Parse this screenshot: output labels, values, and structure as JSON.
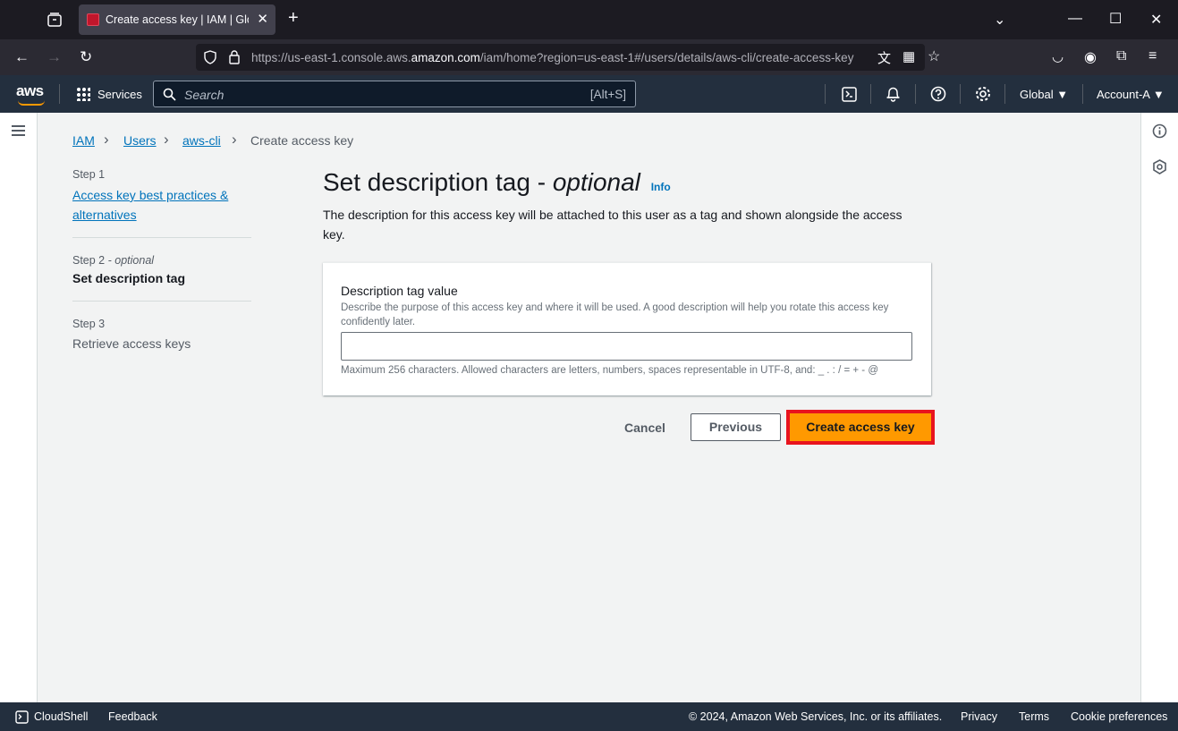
{
  "browser": {
    "tab_title": "Create access key | IAM | Global",
    "url_prefix": "https://us-east-1.console.aws.",
    "url_domain": "amazon.com",
    "url_suffix": "/iam/home?region=us-east-1#/users/details/aws-cli/create-access-key"
  },
  "aws_nav": {
    "logo": "aws",
    "services": "Services",
    "search_placeholder": "Search",
    "search_shortcut": "[Alt+S]",
    "region": "Global",
    "account": "Account-A"
  },
  "breadcrumb": [
    "IAM",
    "Users",
    "aws-cli",
    "Create access key"
  ],
  "steps": [
    {
      "label": "Step 1",
      "title": "Access key best practices & alternatives"
    },
    {
      "label": "Step 2",
      "label_suffix": "- optional",
      "title": "Set description tag"
    },
    {
      "label": "Step 3",
      "title": "Retrieve access keys"
    }
  ],
  "main": {
    "title": "Set description tag - ",
    "title_italic": "optional",
    "info": "Info",
    "description": "The description for this access key will be attached to this user as a tag and shown alongside the access key."
  },
  "form": {
    "label": "Description tag value",
    "description": "Describe the purpose of this access key and where it will be used. A good description will help you rotate this access key confidently later.",
    "value": "",
    "hint": "Maximum 256 characters. Allowed characters are letters, numbers, spaces representable in UTF-8, and: _ . : / = + - @"
  },
  "actions": {
    "cancel": "Cancel",
    "previous": "Previous",
    "create": "Create access key"
  },
  "footer": {
    "cloudshell": "CloudShell",
    "feedback": "Feedback",
    "copyright": "© 2024, Amazon Web Services, Inc. or its affiliates.",
    "privacy": "Privacy",
    "terms": "Terms",
    "cookies": "Cookie preferences"
  },
  "colors": {
    "primary": "#ff9900",
    "highlight_border": "#e8141e",
    "link": "#0073bb",
    "nav_bg": "#232f3e"
  }
}
